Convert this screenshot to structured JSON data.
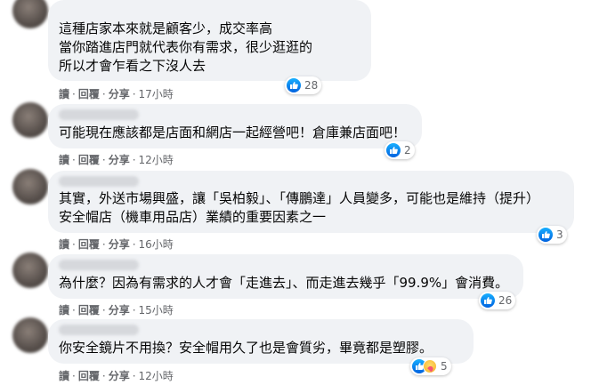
{
  "comments": [
    {
      "lines": [
        "這種店家本來就是顧客少，成交率高",
        "當你踏進店門就代表你有需求，很少逛逛的",
        "所以才會乍看之下沒人去"
      ],
      "actions": {
        "read": "讀",
        "reply": "回覆",
        "share": "分享",
        "time": "17小時"
      },
      "reactions": {
        "count": "28",
        "icons": [
          "like-icon"
        ]
      }
    },
    {
      "lines": [
        "可能現在應該都是店面和網店一起經營吧！倉庫兼店面吧！"
      ],
      "actions": {
        "read": "讀",
        "reply": "回覆",
        "share": "分享",
        "time": "12小時"
      },
      "reactions": {
        "count": "2",
        "icons": [
          "like-icon"
        ]
      }
    },
    {
      "lines": [
        "其實，外送市場興盛，讓「吳柏毅」、「傳鵬達」人員變多，可能也是維持（提升）",
        "安全帽店（機車用品店）業績的重要因素之一"
      ],
      "actions": {
        "read": "讀",
        "reply": "回覆",
        "share": "分享",
        "time": "16小時"
      },
      "reactions": {
        "count": "3",
        "icons": [
          "like-icon"
        ]
      }
    },
    {
      "lines": [
        "為什麼？因為有需求的人才會「走進去」、而走進去幾乎「99.9%」會消費。"
      ],
      "actions": {
        "read": "讀",
        "reply": "回覆",
        "share": "分享",
        "time": "15小時"
      },
      "reactions": {
        "count": "26",
        "icons": [
          "like-icon"
        ]
      }
    },
    {
      "lines": [
        "你安全鏡片不用換？安全帽用久了也是會質劣，畢竟都是塑膠。"
      ],
      "actions": {
        "read": "讀",
        "reply": "回覆",
        "share": "分享",
        "time": "12小時"
      },
      "reactions": {
        "count": "5",
        "icons": [
          "like-icon",
          "care-icon"
        ]
      }
    }
  ],
  "separator": "·",
  "colors": {
    "bubble": "#f0f2f5",
    "meta": "#65676b",
    "like": "#0866ff"
  }
}
